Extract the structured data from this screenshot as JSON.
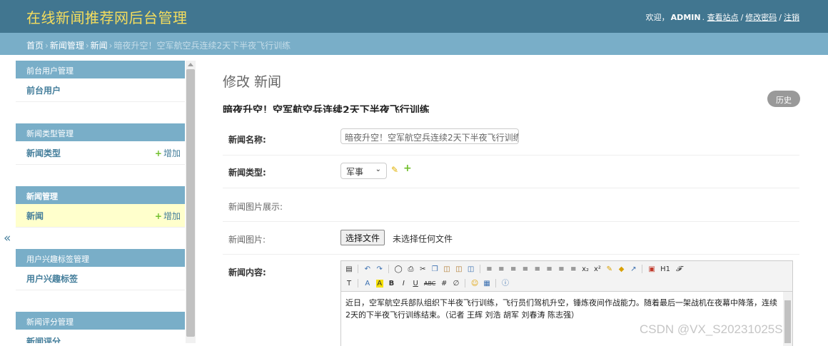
{
  "header": {
    "site_title": "在线新闻推荐网后台管理",
    "welcome": "欢迎，",
    "username": "ADMIN",
    "view_site": "查看站点",
    "change_password": "修改密码",
    "logout": "注销",
    "separator": "/"
  },
  "breadcrumbs": {
    "home": "首页",
    "app": "新闻管理",
    "model": "新闻",
    "current": "暗夜升空！空军航空兵连续2天下半夜飞行训练",
    "arrow": "›"
  },
  "nav_toggle": "«",
  "sidebar": {
    "modules": [
      {
        "caption": "前台用户管理",
        "rows": [
          {
            "label": "前台用户",
            "add": ""
          }
        ]
      },
      {
        "caption": "新闻类型管理",
        "rows": [
          {
            "label": "新闻类型",
            "add": "增加"
          }
        ]
      },
      {
        "caption": "新闻管理",
        "rows": [
          {
            "label": "新闻",
            "add": "增加"
          }
        ]
      },
      {
        "caption": "用户兴趣标签管理",
        "rows": [
          {
            "label": "用户兴趣标签",
            "add": ""
          }
        ]
      },
      {
        "caption": "新闻评分管理",
        "rows": [
          {
            "label": "新闻评分",
            "add": ""
          }
        ]
      }
    ],
    "plus": "+"
  },
  "main": {
    "page_title": "修改 新闻",
    "history_button": "历史",
    "object_title": "暗夜升空！空军航空兵连续2天下半夜飞行训练",
    "fields": {
      "name_label": "新闻名称:",
      "name_value": "暗夜升空！空军航空兵连续2天下半夜飞行训练",
      "type_label": "新闻类型:",
      "type_value": "军事",
      "image_show_label": "新闻图片展示:",
      "image_label": "新闻图片:",
      "file_button": "选择文件",
      "file_none": "未选择任何文件",
      "content_label": "新闻内容:",
      "content_text": "近日，空军航空兵部队组织下半夜飞行训练，飞行员们驾机升空，锤炼夜间作战能力。随着最后一架战机在夜幕中降落，连续2天的下半夜飞行训练结束。（记者 王辉 刘浩 胡军 刘春涛 陈志强）"
    },
    "toolbar": {
      "row1": [
        "source",
        "undo",
        "redo",
        "preview",
        "print",
        "cut",
        "copy",
        "paste",
        "paste-text",
        "paste-word",
        "align-left",
        "align-center",
        "align-right",
        "justify",
        "ordered-list",
        "unordered-list",
        "indent",
        "outdent",
        "subscript",
        "superscript",
        "clear-format",
        "select-all",
        "link",
        "fullscreen",
        "H1",
        "font-family"
      ],
      "row2": [
        "T",
        "A",
        "A",
        "B",
        "I",
        "U",
        "ABC",
        "table",
        "hr",
        "emoticon",
        "image",
        "help"
      ]
    }
  },
  "watermark": "CSDN @VX_S20231025S"
}
